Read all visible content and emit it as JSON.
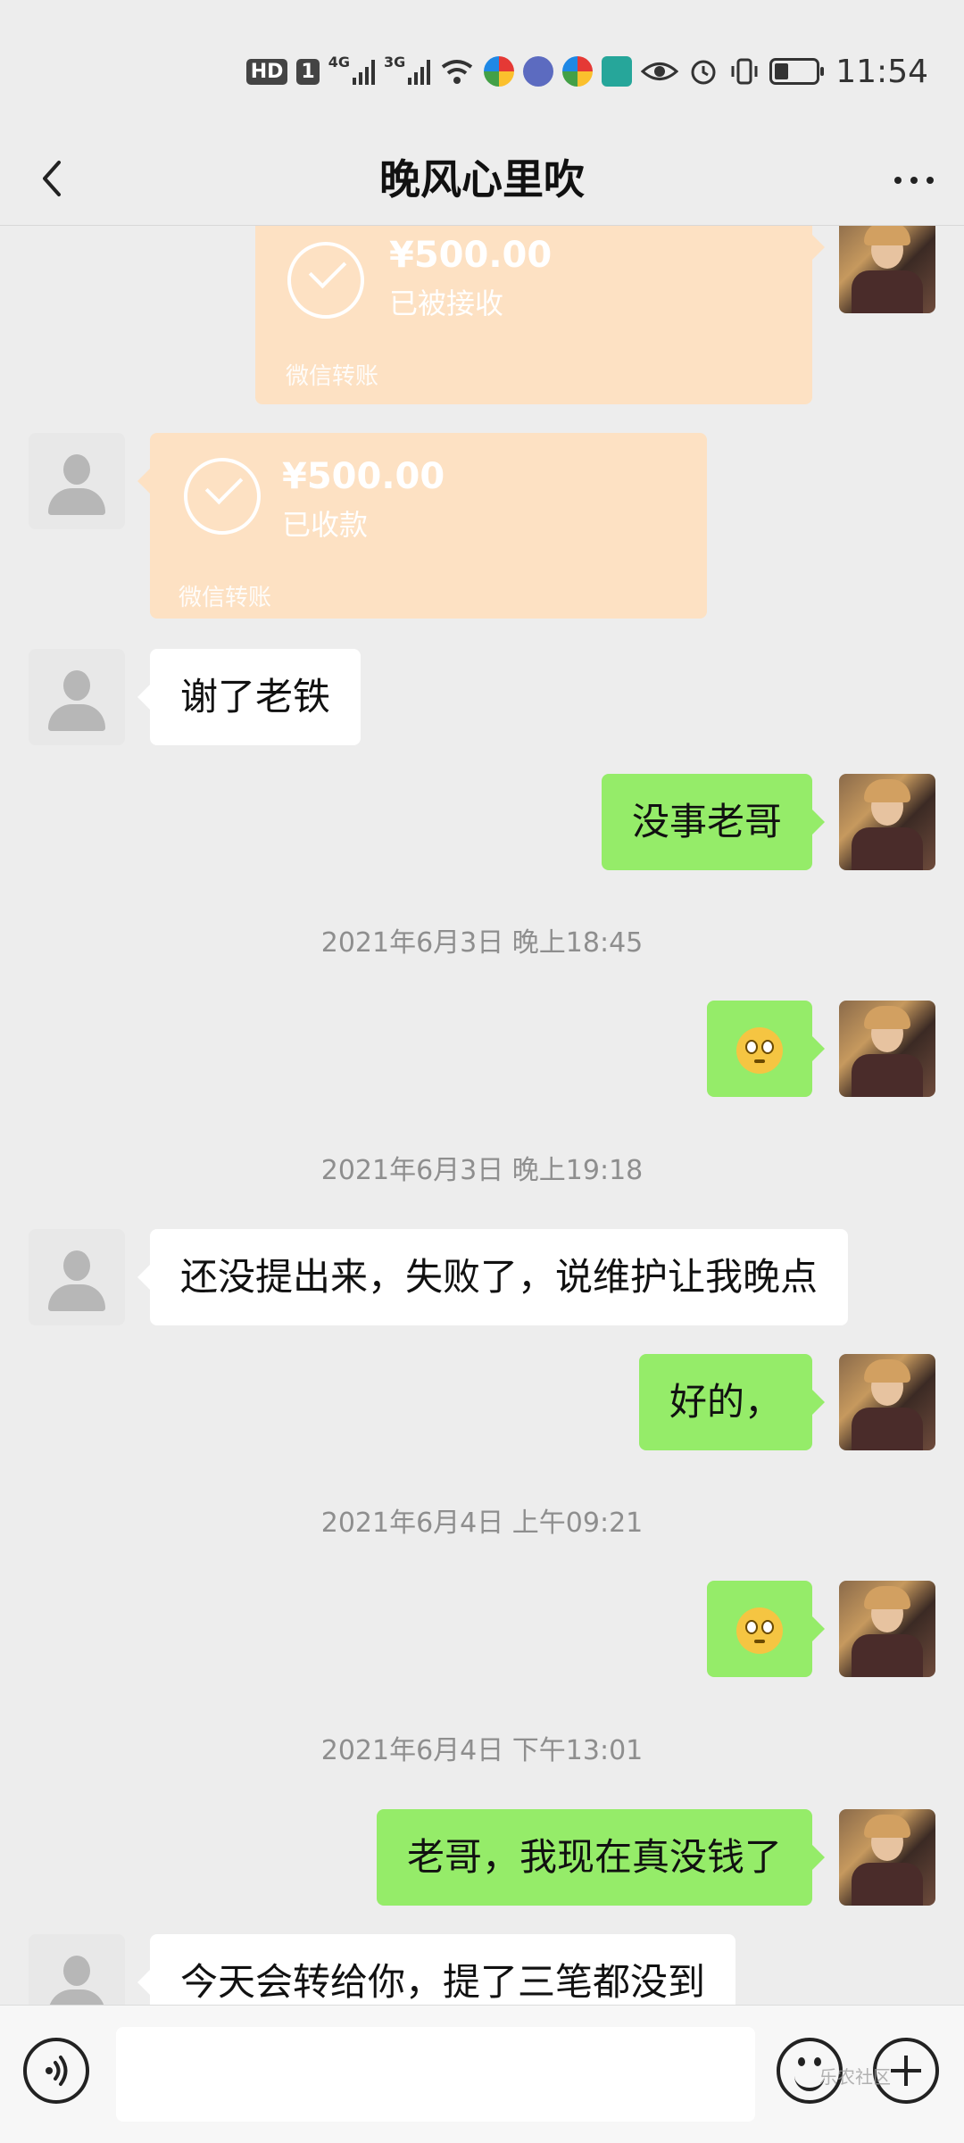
{
  "status_bar": {
    "hd_label": "HD",
    "sim_label": "1",
    "net1_label": "4G",
    "net2_label": "3G",
    "battery_percent": 35,
    "time": "11:54"
  },
  "header": {
    "title": "晚风心里吹"
  },
  "messages": {
    "transfer_1": {
      "amount": "¥500.00",
      "status": "已被接收",
      "source": "微信转账"
    },
    "transfer_2": {
      "amount": "¥500.00",
      "status": "已收款",
      "source": "微信转账"
    },
    "msg_1": "谢了老铁",
    "msg_2": "没事老哥",
    "time_1": "2021年6月3日 晚上18:45",
    "emoji_1": "astonished-face",
    "time_2": "2021年6月3日 晚上19:18",
    "msg_3": "还没提出来，失败了，说维护让我晚点",
    "msg_4": "好的，",
    "time_3": "2021年6月4日 上午09:21",
    "emoji_2": "astonished-face",
    "time_4": "2021年6月4日 下午13:01",
    "msg_5": "老哥，我现在真没钱了",
    "msg_6": "今天会转给你，提了三笔都没到"
  },
  "input_bar": {
    "watermark": "乐农社区"
  },
  "colors": {
    "background": "#ededed",
    "my_bubble": "#95ec69",
    "other_bubble": "#ffffff",
    "transfer_card": "#fde1c3"
  }
}
